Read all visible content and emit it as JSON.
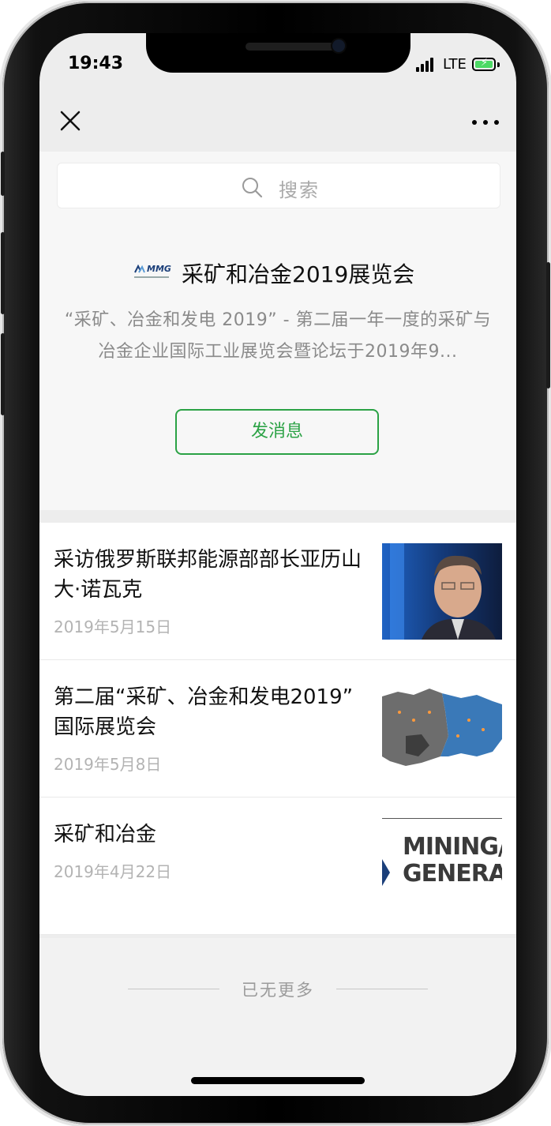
{
  "status_bar": {
    "time": "19:43",
    "network": "LTE",
    "signal_icon": "signal-bars-icon",
    "battery_icon": "battery-charging-icon"
  },
  "nav": {
    "close_icon": "close-icon",
    "more_icon": "more-dots-icon"
  },
  "search": {
    "placeholder": "搜索"
  },
  "profile": {
    "logo_text": "MMG",
    "name": "采矿和冶金2019展览会",
    "description": "“采矿、冶金和发电 2019” - 第二届一年一度的采矿与冶金企业国际工业展览会暨论坛于2019年9...",
    "message_button": "发消息",
    "accent_color": "#2ba245"
  },
  "articles": [
    {
      "title": "采访俄罗斯联邦能源部部长亚历山大·诺瓦克",
      "date": "2019年5月15日",
      "thumb": "portrait-photo"
    },
    {
      "title": "第二届“采矿、冶金和发电2019” 国际展览会",
      "date": "2019年5月8日",
      "thumb": "russia-map"
    },
    {
      "title": "采矿和冶金",
      "date": "2019年4月22日",
      "thumb": "mining-generation-logo",
      "thumb_text_line1": "MINING/M",
      "thumb_text_line2": "GENERATI"
    }
  ],
  "footer": {
    "no_more": "已无更多"
  }
}
